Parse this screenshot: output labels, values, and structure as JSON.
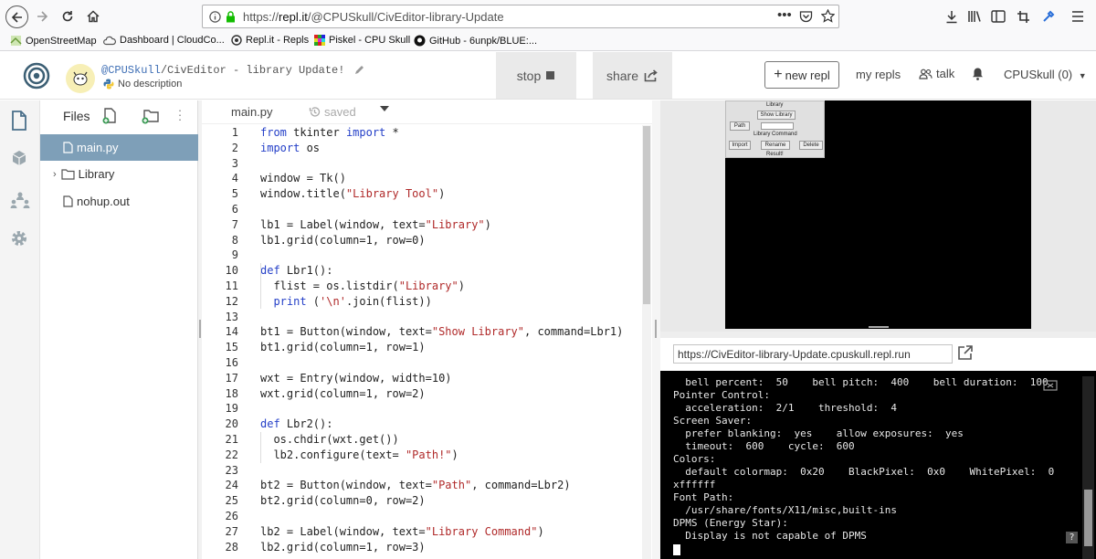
{
  "browser": {
    "url_prefix": "https://",
    "url_host": "repl.it",
    "url_path": "/@CPUSkull/CivEditor-library-Update",
    "bookmarks": [
      "OpenStreetMap",
      "Dashboard | CloudCo...",
      "Repl.it - Repls",
      "Piskel - CPU Skull",
      "GitHub - 6unpk/BLUE:..."
    ]
  },
  "header": {
    "user": "@CPUSkull",
    "separator": "/",
    "repl_name": "CivEditor - library Update!",
    "description": "No description",
    "stop_label": "stop",
    "share_label": "share",
    "new_repl_label": "new repl",
    "my_repls_label": "my repls",
    "talk_label": "talk",
    "account_label": "CPUSkull (0)"
  },
  "files": {
    "title": "Files",
    "items": [
      {
        "label": "main.py",
        "type": "file"
      },
      {
        "label": "Library",
        "type": "folder"
      },
      {
        "label": "nohup.out",
        "type": "file"
      }
    ]
  },
  "editor": {
    "tab_label": "main.py",
    "saved_label": "saved",
    "line_numbers": [
      "1",
      "2",
      "3",
      "4",
      "5",
      "6",
      "7",
      "8",
      "9",
      "10",
      "11",
      "12",
      "13",
      "14",
      "15",
      "16",
      "17",
      "18",
      "19",
      "20",
      "21",
      "22",
      "23",
      "24",
      "25",
      "26",
      "27",
      "28"
    ]
  },
  "output": {
    "tk_title": "Library",
    "tk_show_library": "Show Library",
    "tk_path": "Path",
    "tk_library_command": "Library Command",
    "tk_import": "Import",
    "tk_rename": "Rename",
    "tk_delete": "Delete",
    "tk_result": "Result!",
    "run_url": "https://CivEditor-library-Update.cpuskull.repl.run",
    "console_lines": [
      "  bell percent:  50    bell pitch:  400    bell duration:  100",
      "Pointer Control:",
      "  acceleration:  2/1    threshold:  4",
      "Screen Saver:",
      "  prefer blanking:  yes    allow exposures:  yes",
      "  timeout:  600    cycle:  600",
      "Colors:",
      "  default colormap:  0x20    BlackPixel:  0x0    WhitePixel:  0",
      "xffffff",
      "Font Path:",
      "  /usr/share/fonts/X11/misc,built-ins",
      "DPMS (Energy Star):",
      "  Display is not capable of DPMS"
    ]
  },
  "colors": {
    "accent_selected_file": "#7e9fb8",
    "keyword": "#2540c8",
    "string": "#b02a2a",
    "console_bg": "#000000"
  }
}
